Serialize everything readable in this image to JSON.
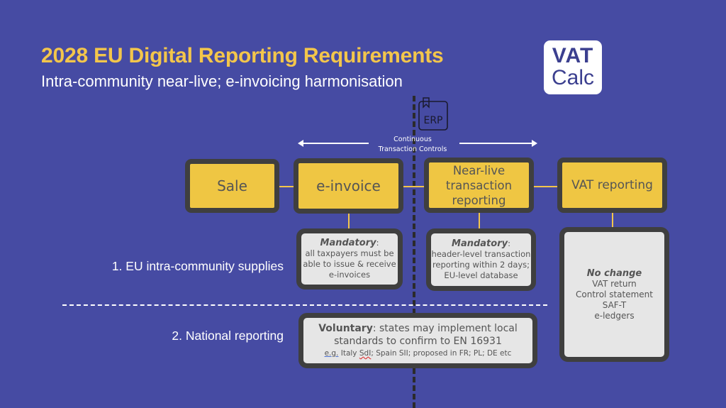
{
  "header": {
    "title": "2028 EU Digital Reporting Requirements",
    "subtitle": "Intra-community near-live; e-invoicing harmonisation"
  },
  "logo": {
    "line1": "VAT",
    "line2": "Calc"
  },
  "erp_icon": {
    "label": "ERP",
    "icon": "erp-book-icon"
  },
  "ctc": {
    "line1": "Continuous",
    "line2": "Transaction Controls"
  },
  "process_steps": [
    {
      "label": "Sale"
    },
    {
      "label": "e-invoice"
    },
    {
      "label": "Near-live transaction reporting"
    },
    {
      "label": "VAT reporting"
    }
  ],
  "rows": [
    {
      "label": "1. EU intra-community supplies"
    },
    {
      "label": "2. National reporting"
    }
  ],
  "detail_boxes": {
    "einvoice": {
      "heading": "Mandatory",
      "suffix": ":",
      "body": [
        "all taxpayers must be",
        "able to issue & receive",
        "e-invoices"
      ]
    },
    "near_live": {
      "heading": "Mandatory",
      "suffix": ":",
      "body": [
        "header-level transaction",
        "reporting within 2 days;",
        "EU-level database"
      ]
    },
    "vat_reporting": {
      "heading": "No change",
      "body": [
        "VAT return",
        "Control statement",
        "SAF-T",
        "e-ledgers"
      ]
    },
    "national": {
      "heading": "Voluntary",
      "line1_rest": ": states may implement local",
      "line2": "standards to confirm to EN 16931",
      "eg": "e.g.",
      "sdi_prefix": " Italy ",
      "sdi": "SdI",
      "rest": "; Spain SII; proposed in FR; PL; DE etc"
    }
  },
  "colors": {
    "background": "#464ba3",
    "accent_yellow": "#f3c64b",
    "box_yellow": "#efc643",
    "box_border": "#3f3f3f",
    "box_grey": "#e6e6e6"
  }
}
